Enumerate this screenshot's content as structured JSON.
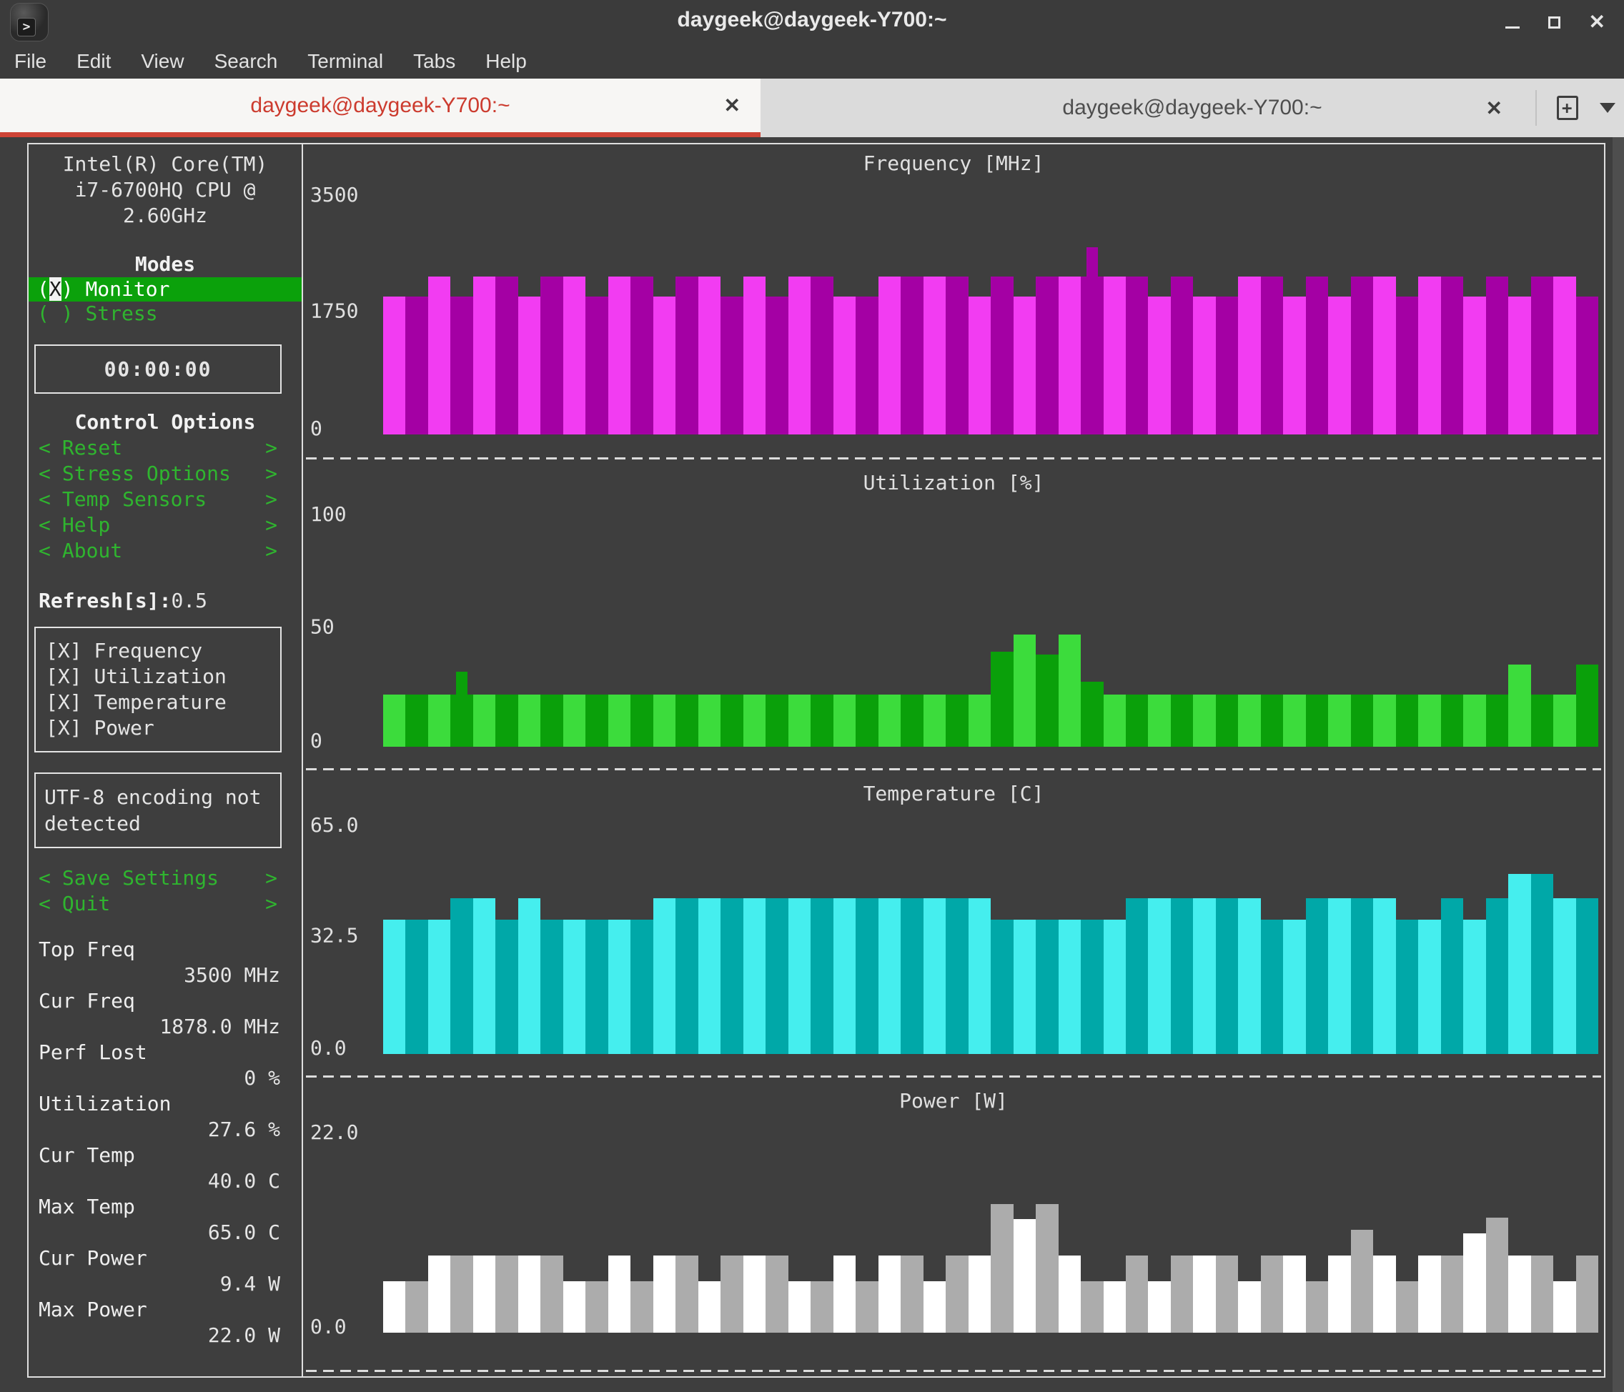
{
  "window": {
    "title": "daygeek@daygeek-Y700:~",
    "controls": [
      {
        "icon": "minimize-icon"
      },
      {
        "icon": "maximize-icon"
      },
      {
        "icon": "close-icon"
      }
    ]
  },
  "menu": {
    "items": [
      "File",
      "Edit",
      "View",
      "Search",
      "Terminal",
      "Tabs",
      "Help"
    ]
  },
  "tabs": [
    {
      "label": "daygeek@daygeek-Y700:~",
      "active": true,
      "close_icon": "x"
    },
    {
      "label": "daygeek@daygeek-Y700:~",
      "active": false,
      "close_icon": "x"
    }
  ],
  "sidebar": {
    "cpu_name_lines": [
      "Intel(R) Core(TM)",
      "i7-6700HQ CPU @",
      "2.60GHz"
    ],
    "modes": {
      "heading": "Modes",
      "options": [
        {
          "prefix": "(",
          "mark": "X",
          "suffix": ")",
          "label": "Monitor",
          "selected": true
        },
        {
          "prefix": "(",
          "mark": " ",
          "suffix": ")",
          "label": "Stress",
          "selected": false
        }
      ]
    },
    "timer": "00:00:00",
    "control_options": {
      "heading": "Control Options",
      "bracket_open": "<",
      "bracket_close": ">",
      "items": [
        "Reset",
        "Stress Options",
        "Temp Sensors",
        "Help",
        "About"
      ]
    },
    "refresh": {
      "label": "Refresh[s]:",
      "value": "0.5"
    },
    "toggles": [
      {
        "glyph": "[X]",
        "label": "Frequency"
      },
      {
        "glyph": "[X]",
        "label": "Utilization"
      },
      {
        "glyph": "[X]",
        "label": "Temperature"
      },
      {
        "glyph": "[X]",
        "label": "Power"
      }
    ],
    "notice": "UTF-8 encoding not detected",
    "actions": [
      {
        "open": "<",
        "label": "Save Settings",
        "close": ">"
      },
      {
        "open": "<",
        "label": "Quit",
        "close": ">"
      }
    ],
    "stats": [
      {
        "label": "Top Freq",
        "value": "3500 MHz"
      },
      {
        "label": "Cur Freq",
        "value": "1878.0 MHz"
      },
      {
        "label": "Perf Lost",
        "value": "0 %"
      },
      {
        "label": "Utilization",
        "value": "27.6 %"
      },
      {
        "label": "Cur Temp",
        "value": "40.0 C"
      },
      {
        "label": "Max Temp",
        "value": "65.0 C"
      },
      {
        "label": "Cur Power",
        "value": "9.4 W"
      },
      {
        "label": "Max Power",
        "value": "22.0 W"
      }
    ]
  },
  "chart_data": [
    {
      "type": "bar",
      "title": "Frequency [MHz]",
      "xlabel": "",
      "ylabel": "MHz",
      "ylim": [
        0,
        3500
      ],
      "yticks": [
        "3500",
        "1750",
        "0"
      ],
      "grid": false,
      "legend": "none",
      "bar_colors": [
        "#F23CF2",
        "#A400A4"
      ],
      "values": [
        1880,
        1880,
        2150,
        1880,
        2150,
        2150,
        1880,
        2150,
        2150,
        1880,
        2150,
        2150,
        1880,
        2150,
        2150,
        1880,
        2150,
        1880,
        2150,
        2150,
        1880,
        1880,
        2150,
        2150,
        2150,
        2150,
        1880,
        2150,
        1880,
        2150,
        2150,
        2150,
        2150,
        2150,
        1880,
        2150,
        1880,
        1880,
        2150,
        2150,
        1880,
        2150,
        1880,
        2150,
        2150,
        1880,
        2150,
        2150,
        1880,
        2150,
        1880,
        2150,
        2150,
        1880
      ],
      "spikes": [
        {
          "index": 31,
          "value": 2550
        }
      ]
    },
    {
      "type": "bar",
      "title": "Utilization [%]",
      "xlabel": "",
      "ylabel": "%",
      "ylim": [
        0,
        100
      ],
      "yticks": [
        "100",
        "50",
        "0"
      ],
      "grid": false,
      "legend": "none",
      "bar_colors": [
        "#3CDC3C",
        "#0AA00A"
      ],
      "values": [
        21,
        21,
        21,
        21,
        21,
        21,
        21,
        21,
        21,
        21,
        21,
        21,
        21,
        21,
        21,
        21,
        21,
        21,
        21,
        21,
        21,
        21,
        21,
        21,
        21,
        21,
        21,
        38,
        45,
        37,
        45,
        26,
        21,
        21,
        21,
        21,
        21,
        21,
        21,
        21,
        21,
        21,
        21,
        21,
        21,
        21,
        21,
        21,
        21,
        21,
        33,
        21,
        21,
        33
      ],
      "spikes": [
        {
          "index": 3,
          "value": 30
        }
      ]
    },
    {
      "type": "bar",
      "title": "Temperature [C]",
      "xlabel": "",
      "ylabel": "C",
      "ylim": [
        0,
        65
      ],
      "yticks": [
        "65.0",
        "32.5",
        "0.0"
      ],
      "grid": false,
      "legend": "none",
      "bar_colors": [
        "#45EEEE",
        "#00A8A8"
      ],
      "values": [
        35.5,
        35.5,
        35.5,
        41,
        41,
        35.5,
        41,
        35.5,
        35.5,
        35.5,
        35.5,
        35.5,
        41,
        41,
        41,
        41,
        41,
        41,
        41,
        41,
        41,
        41,
        41,
        41,
        41,
        41,
        41,
        35.5,
        35.5,
        35.5,
        35.5,
        35.5,
        35.5,
        41,
        41,
        41,
        41,
        41,
        41,
        35.5,
        35.5,
        41,
        41,
        41,
        41,
        35.5,
        35.5,
        41,
        35.5,
        41,
        47.5,
        47.5,
        41,
        41
      ],
      "spikes": []
    },
    {
      "type": "bar",
      "title": "Power [W]",
      "xlabel": "",
      "ylabel": "W",
      "ylim": [
        0,
        22
      ],
      "yticks": [
        "22.0",
        "0.0"
      ],
      "grid": false,
      "legend": "none",
      "bar_colors": [
        "#FFFFFF",
        "#ACACAC"
      ],
      "values": [
        5.2,
        5.2,
        7.8,
        7.8,
        7.8,
        7.8,
        7.8,
        7.8,
        5.2,
        5.2,
        7.8,
        5.2,
        7.8,
        7.8,
        5.2,
        7.8,
        7.8,
        7.8,
        5.2,
        5.2,
        7.8,
        5.2,
        7.8,
        7.8,
        5.2,
        7.8,
        7.8,
        13,
        11.5,
        13,
        7.8,
        5.2,
        5.2,
        7.8,
        5.2,
        7.8,
        7.8,
        7.8,
        5.2,
        7.8,
        7.8,
        5.2,
        7.8,
        10.4,
        7.8,
        5.2,
        7.8,
        7.8,
        10,
        11.6,
        7.8,
        7.8,
        5.2,
        7.8
      ],
      "spikes": []
    }
  ]
}
